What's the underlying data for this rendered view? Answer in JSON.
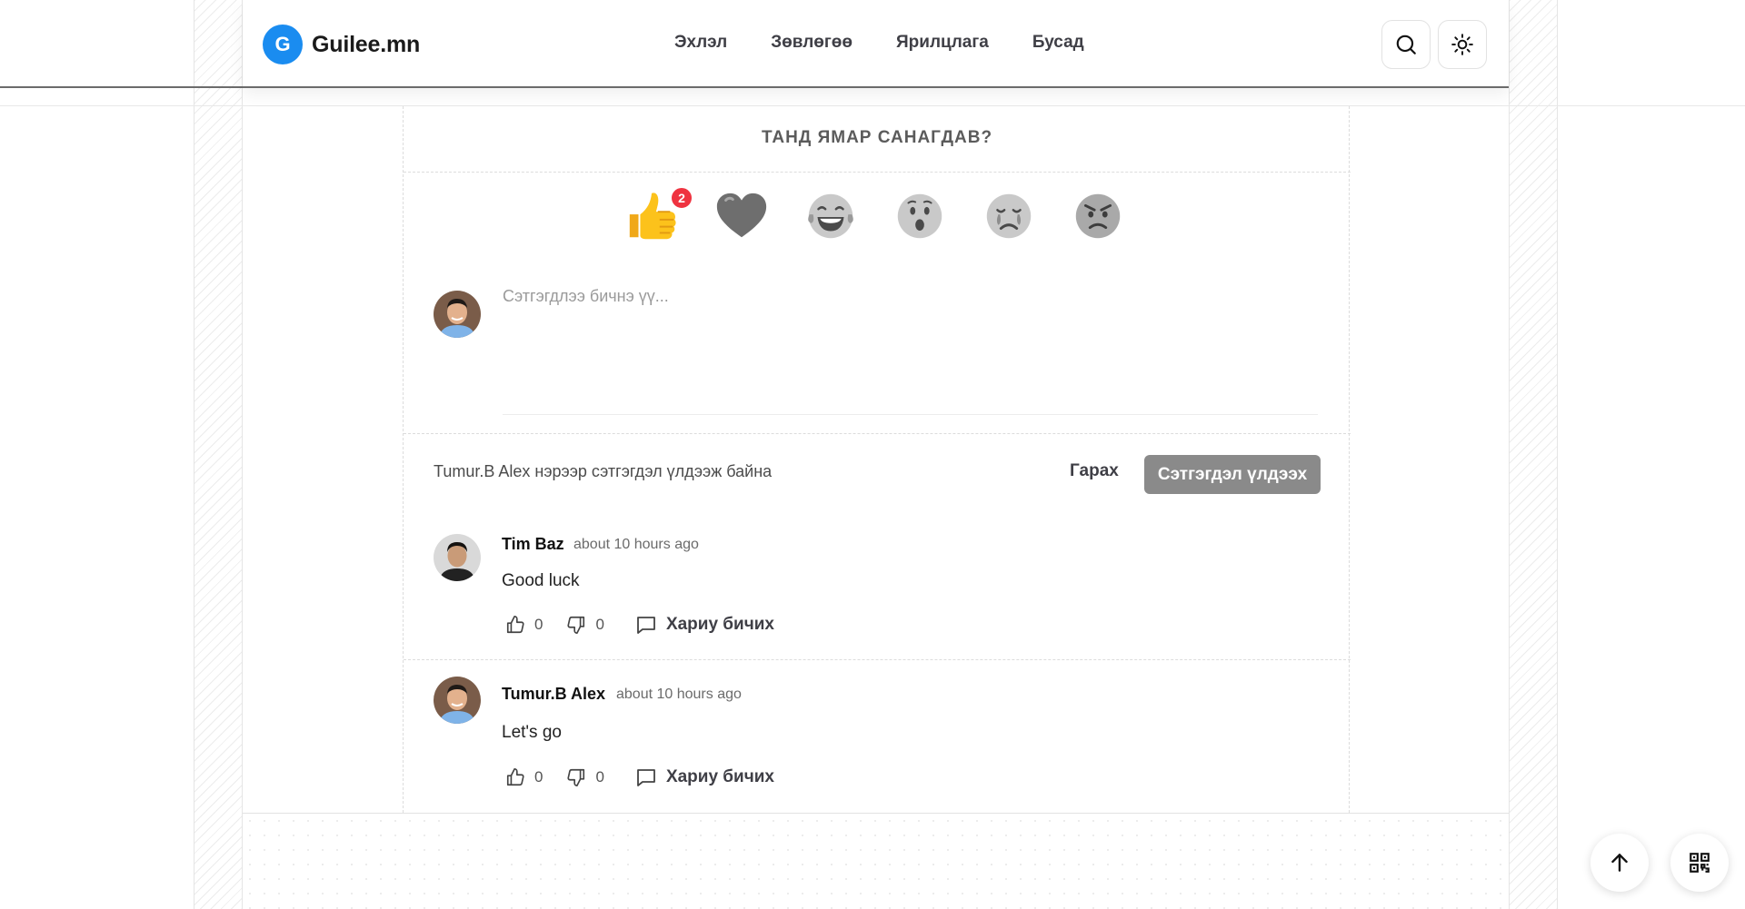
{
  "header": {
    "brand_letter": "G",
    "brand_name": "Guilee.mn",
    "nav": [
      "Эхлэл",
      "Зөвлөгөө",
      "Ярилцлага",
      "Бусад"
    ]
  },
  "colors": {
    "brand_blue": "#1a8cf0",
    "badge_red": "#ef3340",
    "submit_gray": "#8a8a8a"
  },
  "reactions": {
    "title": "ТАНД ЯМАР САНАГДАВ?",
    "items": [
      {
        "icon": "thumbs-up-icon",
        "count": "2"
      },
      {
        "icon": "heart-icon"
      },
      {
        "icon": "laughing-icon"
      },
      {
        "icon": "surprised-icon"
      },
      {
        "icon": "sad-icon"
      },
      {
        "icon": "angry-icon"
      }
    ]
  },
  "composer": {
    "placeholder": "Сэтгэгдлээ бичнэ үү...",
    "status": "Tumur.B Alex нэрээр сэтгэгдэл үлдээж байна",
    "logout_label": "Гарах",
    "submit_label": "Сэтгэгдэл үлдээх"
  },
  "comments": [
    {
      "author": "Tim Baz",
      "time": "about 10 hours ago",
      "text": "Good luck",
      "likes": "0",
      "dislikes": "0",
      "reply_label": "Хариу бичих"
    },
    {
      "author": "Tumur.B Alex",
      "time": "about 10 hours ago",
      "text": "Let's go",
      "likes": "0",
      "dislikes": "0",
      "reply_label": "Хариу бичих"
    }
  ]
}
